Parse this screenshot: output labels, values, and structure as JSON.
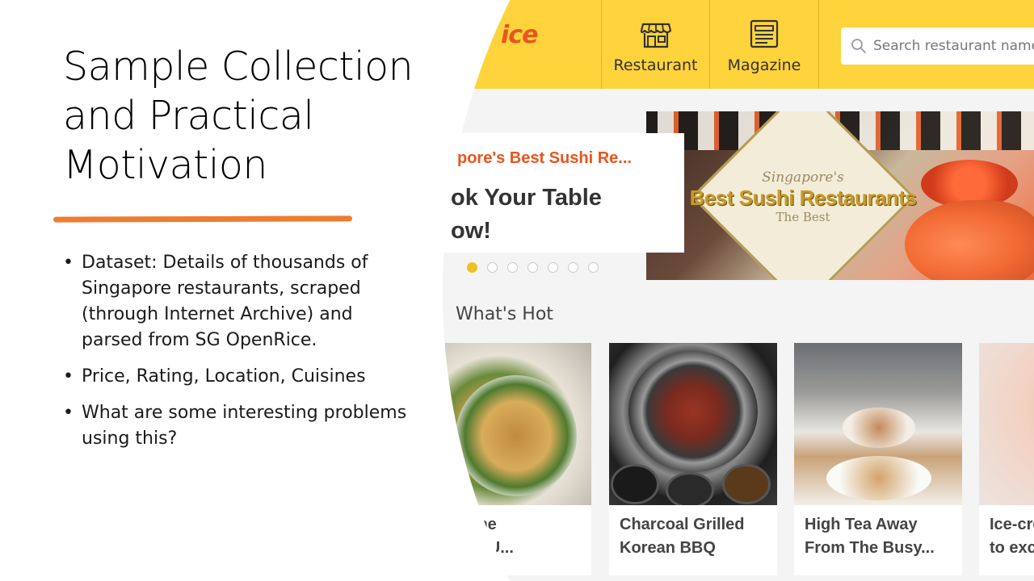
{
  "slide": {
    "title": "Sample Collection and Practical Motivation",
    "bullets": [
      "Dataset: Details of thousands of Singapore restaurants, scraped (through Internet Archive) and parsed from SG OpenRice.",
      "Price, Rating, Location, Cuisines",
      "What are some interesting problems using this?"
    ],
    "accent_color": "#ed7d31"
  },
  "site": {
    "brand_color": "#ffd33b",
    "logo_text": "ice",
    "logo_color": "#e8551f",
    "nav": [
      {
        "label": "Restaurant",
        "icon": "storefront-icon"
      },
      {
        "label": "Magazine",
        "icon": "newspaper-icon"
      }
    ],
    "search": {
      "placeholder": "Search restaurant name,"
    },
    "banner": {
      "kicker": "pore's Best Sushi Re...",
      "headline_line1": "ok Your Table",
      "headline_line2": "ow!",
      "image_text_top": "Singapore's",
      "image_text_main": "Best Sushi Restaurants",
      "image_text_sub": "The Best",
      "dot_count": 7,
      "active_dot": 0
    },
    "whats_hot": {
      "title": "What's Hot",
      "cards": [
        {
          "line1": "ere! The",
          "line2": "waited U..."
        },
        {
          "line1": "Charcoal Grilled",
          "line2": "Korean BBQ"
        },
        {
          "line1": "High Tea Away",
          "line2": "From The Busy..."
        },
        {
          "line1": "Ice-cre",
          "line2": "to exc"
        }
      ]
    }
  }
}
